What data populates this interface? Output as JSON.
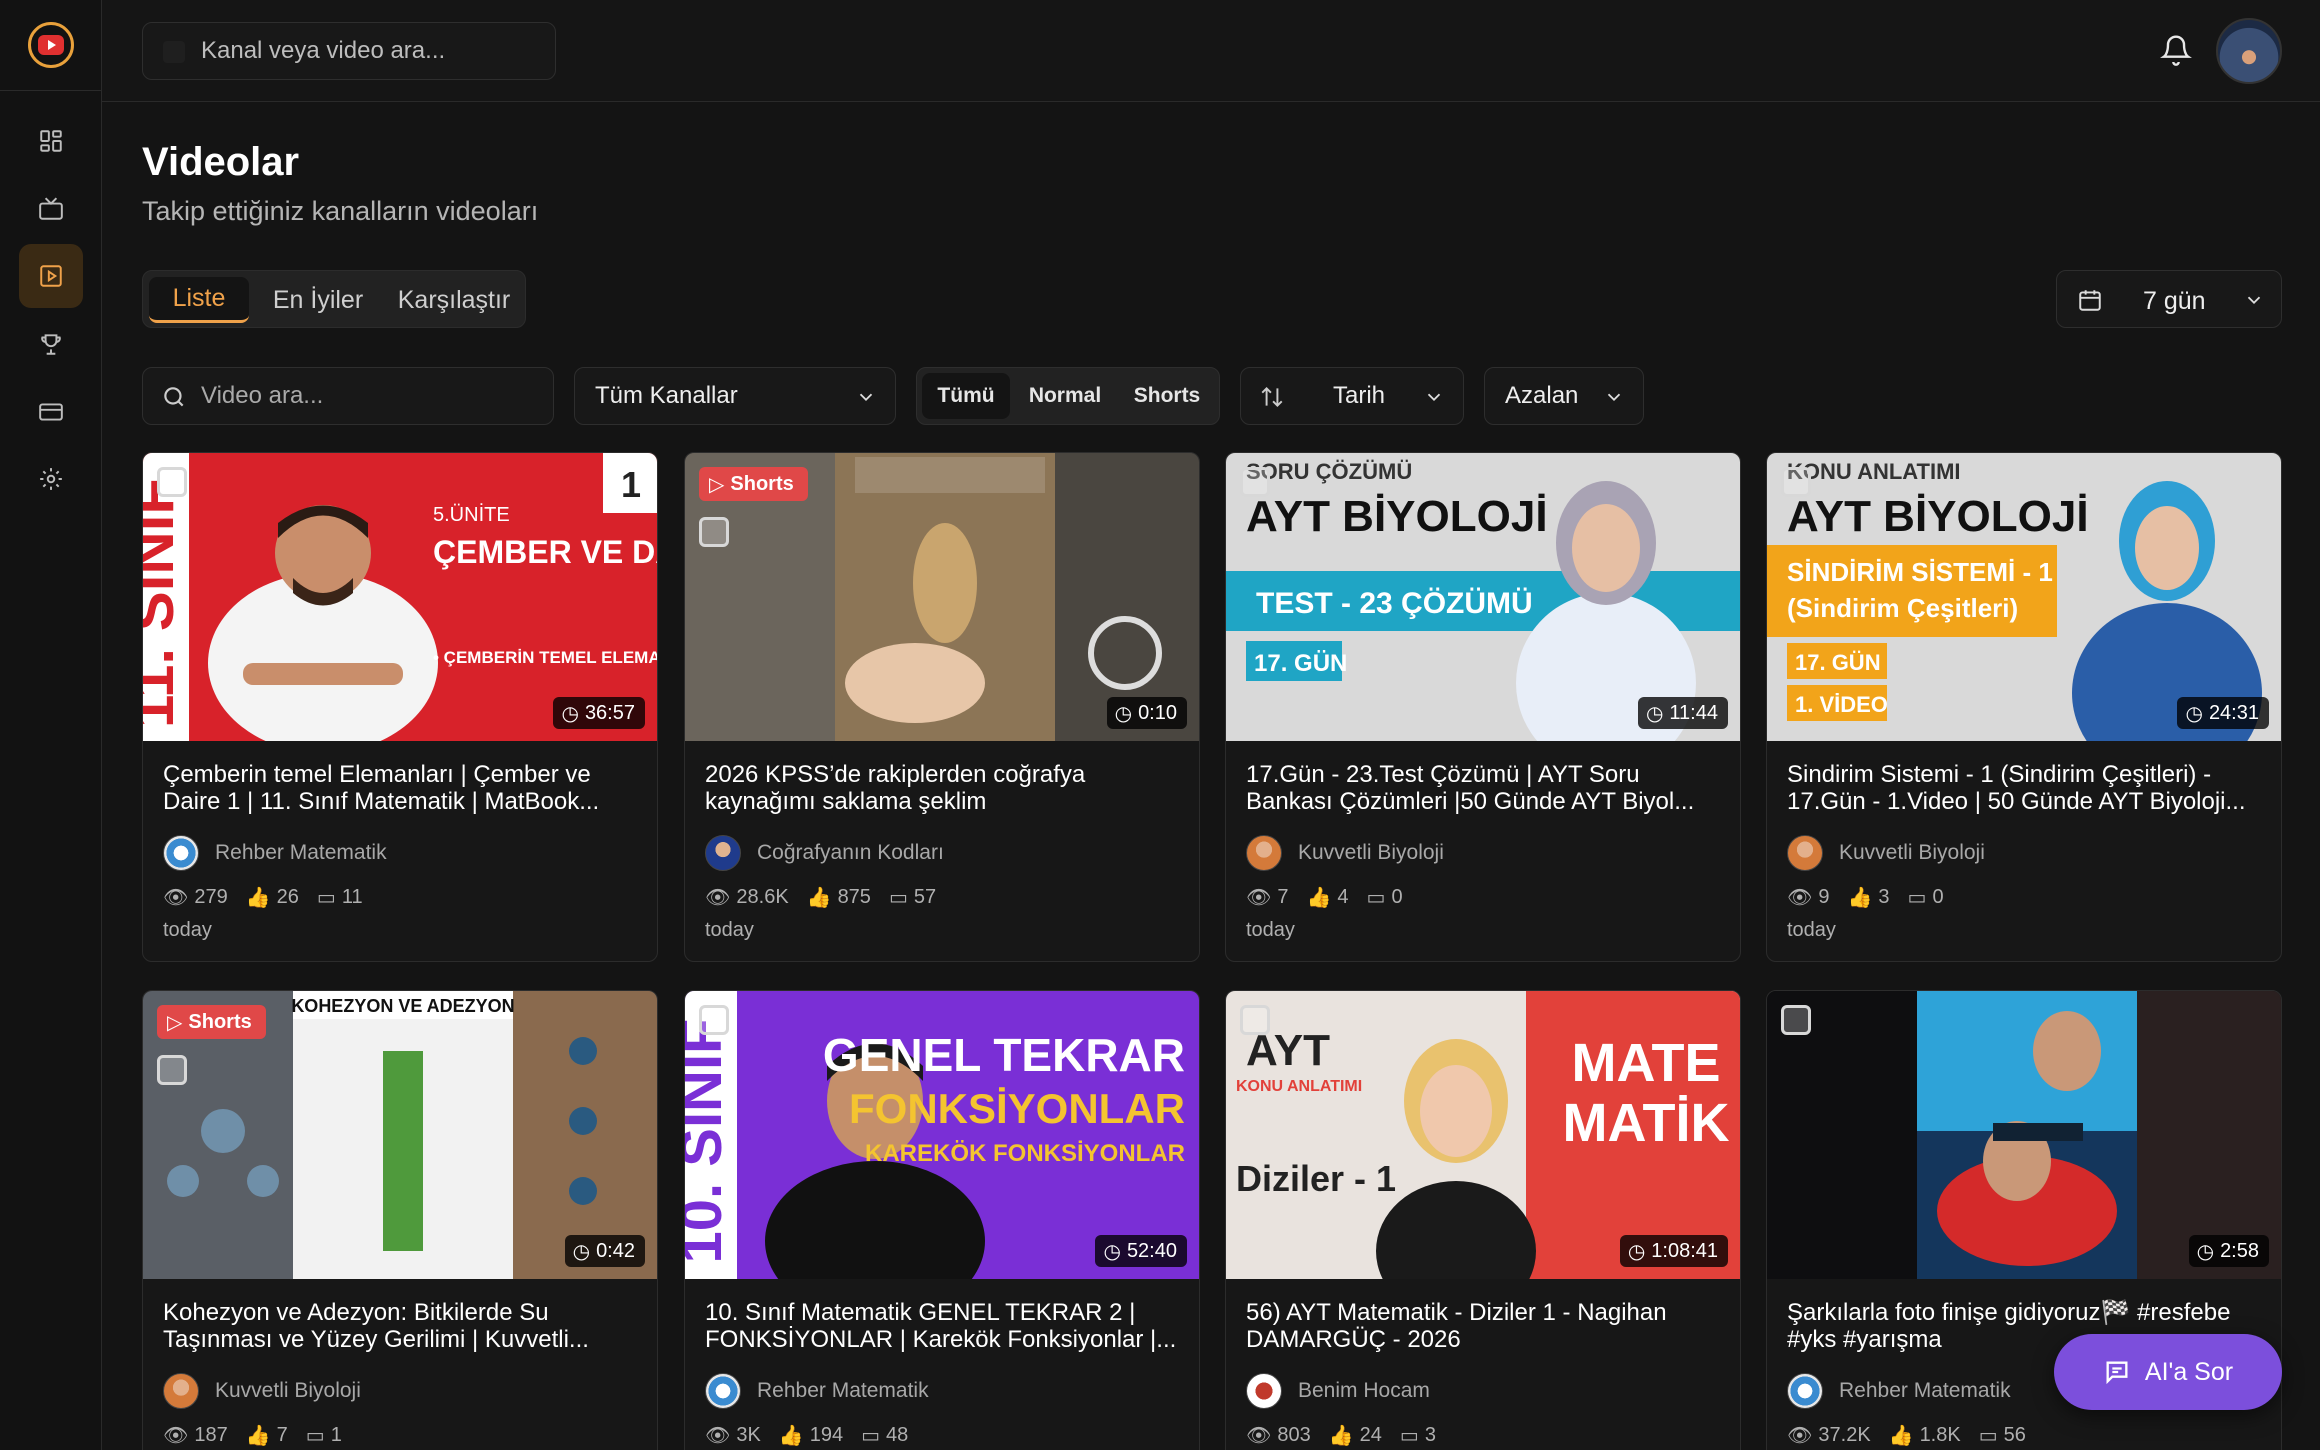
{
  "topbar": {
    "search_placeholder": "Kanal veya video ara...",
    "bell_icon": "bell-icon",
    "avatar": "user-avatar"
  },
  "sidebar": {
    "items": [
      {
        "icon": "dashboard-icon",
        "active": false
      },
      {
        "icon": "tv-icon",
        "active": false
      },
      {
        "icon": "video-play-icon",
        "active": true
      },
      {
        "icon": "trophy-icon",
        "active": false
      },
      {
        "icon": "credit-card-icon",
        "active": false
      },
      {
        "icon": "settings-icon",
        "active": false
      }
    ]
  },
  "page": {
    "title": "Videolar",
    "subtitle": "Takip ettiğiniz kanalların videoları"
  },
  "tabs": [
    "Liste",
    "En İyiler",
    "Karşılaştır"
  ],
  "date_range": "7 gün",
  "filters": {
    "search_placeholder": "Video ara...",
    "channels": "Tüm Kanallar",
    "type_options": [
      "Tümü",
      "Normal",
      "Shorts"
    ],
    "sort": "Tarih",
    "order": "Azalan"
  },
  "videos": [
    {
      "title": "Çemberin temel Elemanları | Çember ve Daire 1 | 11. Sınıf Matematik | MatBook...",
      "channel": "Rehber Matematik",
      "views": "279",
      "likes": "26",
      "comments": "11",
      "when": "today",
      "duration": "36:57",
      "shorts": false
    },
    {
      "title": "2026 KPSS’de rakiplerden coğrafya kaynağımı saklama şeklim",
      "channel": "Coğrafyanın Kodları",
      "views": "28.6K",
      "likes": "875",
      "comments": "57",
      "when": "today",
      "duration": "0:10",
      "shorts": true
    },
    {
      "title": "17.Gün - 23.Test Çözümü | AYT Soru Bankası Çözümleri |50 Günde AYT Biyol...",
      "channel": "Kuvvetli Biyoloji",
      "views": "7",
      "likes": "4",
      "comments": "0",
      "when": "today",
      "duration": "11:44",
      "shorts": false
    },
    {
      "title": "Sindirim Sistemi - 1 (Sindirim Çeşitleri) - 17.Gün - 1.Video | 50 Günde AYT Biyoloji...",
      "channel": "Kuvvetli Biyoloji",
      "views": "9",
      "likes": "3",
      "comments": "0",
      "when": "today",
      "duration": "24:31",
      "shorts": false
    },
    {
      "title": "Kohezyon ve Adezyon: Bitkilerde Su Taşınması ve Yüzey Gerilimi | Kuvvetli...",
      "channel": "Kuvvetli Biyoloji",
      "views": "187",
      "likes": "7",
      "comments": "1",
      "when": "",
      "duration": "0:42",
      "shorts": true
    },
    {
      "title": "10. Sınıf Matematik GENEL TEKRAR 2 | FONKSİYONLAR | Karekök Fonksiyonlar |...",
      "channel": "Rehber Matematik",
      "views": "3K",
      "likes": "194",
      "comments": "48",
      "when": "",
      "duration": "52:40",
      "shorts": false
    },
    {
      "title": "56) AYT Matematik - Diziler 1 - Nagihan DAMARGÜÇ - 2026",
      "channel": "Benim Hocam",
      "views": "803",
      "likes": "24",
      "comments": "3",
      "when": "",
      "duration": "1:08:41",
      "shorts": false
    },
    {
      "title": "Şarkılarla foto finişe gidiyoruz🏁 #resfebe #yks #yarışma",
      "channel": "Rehber Matematik",
      "views": "37.2K",
      "likes": "1.8K",
      "comments": "56",
      "when": "",
      "duration": "2:58",
      "shorts": false
    }
  ],
  "thumb_text": {
    "t1_unit": "5.ÜNİTE",
    "t1_main": "ÇEMBER VE DAİRE",
    "t1_sub": "• ÇEMBERİN TEMEL ELEMANLARI",
    "t1_side": "11. SINIF",
    "t1_num": "1",
    "t3_top": "SORU ÇÖZÜMÜ",
    "t3_main": "AYT BİYOLOJİ",
    "t3_band": "TEST - 23 ÇÖZÜMÜ",
    "t3_day": "17. GÜN",
    "t4_top": "KONU ANLATIMI",
    "t4_main": "AYT BİYOLOJİ",
    "t4_band1": "SİNDİRİM SİSTEMİ - 1",
    "t4_band2": "(Sindirim Çeşitleri)",
    "t4_day": "17. GÜN",
    "t4_vid": "1. VİDEO",
    "t5_head": "KOHEZYON VE ADEZYON",
    "t6_side": "10. SINIF",
    "t6_l1": "GENEL TEKRAR",
    "t6_l2": "FONKSİYONLAR",
    "t6_l3": "KAREKÖK FONKSİYONLAR",
    "t7_ayt": "AYT",
    "t7_konu": "KONU ANLATIMI",
    "t7_mate": "MATE",
    "t7_matik": "MATİK",
    "t7_dizi": "Diziler - 1"
  },
  "ai_button": "AI'a Sor",
  "colors": {
    "accent": "#f0a24a",
    "ai": "#7c4fdc",
    "shorts": "#e04848"
  }
}
